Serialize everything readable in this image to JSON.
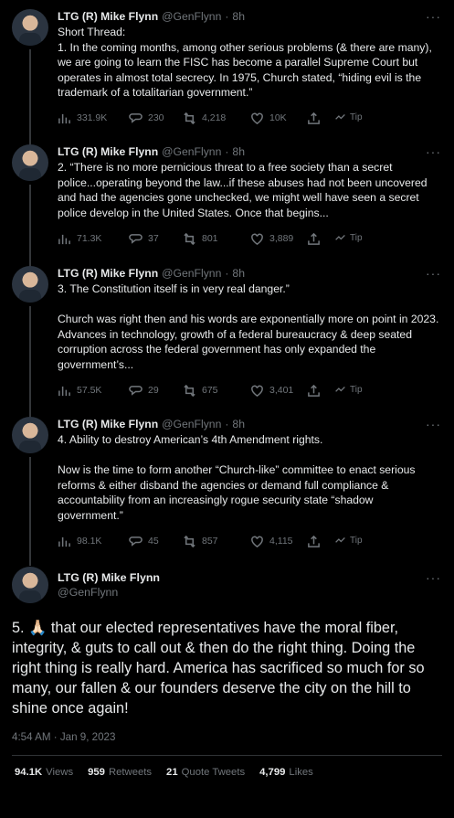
{
  "author": {
    "name": "LTG (R) Mike Flynn",
    "handle": "@GenFlynn",
    "time": "8h"
  },
  "thread": [
    {
      "text": "Short Thread:\n1. In the coming months, among other serious problems (& there are many), we are going to learn the FISC has become a parallel Supreme Court but operates in almost total secrecy. In 1975, Church stated, “hiding evil is the trademark of a totalitarian government.”",
      "views": "331.9K",
      "replies": "230",
      "retweets": "4,218",
      "likes": "10K"
    },
    {
      "text": "2. “There is no more pernicious threat to a free society than a secret police...operating beyond the law...if these abuses had not been uncovered and had the agencies gone unchecked, we might well have seen a secret police develop in the United States. Once that begins...",
      "views": "71.3K",
      "replies": "37",
      "retweets": "801",
      "likes": "3,889"
    },
    {
      "text": "3. The Constitution itself is in very real danger.”\n\nChurch was right then and his words are exponentially more on point in 2023. Advances in technology, growth of a federal bureaucracy & deep seated corruption across the federal government has only expanded the government’s...",
      "views": "57.5K",
      "replies": "29",
      "retweets": "675",
      "likes": "3,401"
    },
    {
      "text": "4. Ability to destroy American’s 4th Amendment rights.\n\nNow is the time to form another “Church-like” committee to enact serious reforms & either disband the agencies or demand full compliance & accountability from an increasingly rogue security state “shadow government.”",
      "views": "98.1K",
      "replies": "45",
      "retweets": "857",
      "likes": "4,115"
    }
  ],
  "tip_label": "Tip",
  "main": {
    "name": "LTG (R) Mike Flynn",
    "handle": "@GenFlynn",
    "text": "5. 🙏🏻 that our elected representatives have the moral fiber, integrity, & guts to call out & then do the right thing. Doing the right thing is really hard. America has sacrificed so much for so many, our fallen & our founders deserve the city on the hill to shine once again!",
    "timestamp": "4:54 AM · Jan 9, 2023",
    "stats": {
      "views_count": "94.1K",
      "views_label": "Views",
      "retweets_count": "959",
      "retweets_label": "Retweets",
      "quotes_count": "21",
      "quotes_label": "Quote Tweets",
      "likes_count": "4,799",
      "likes_label": "Likes"
    }
  },
  "colors": {
    "background": "#000000",
    "text": "#e7e9ea",
    "muted": "#71767b",
    "divider": "#2f3336"
  }
}
